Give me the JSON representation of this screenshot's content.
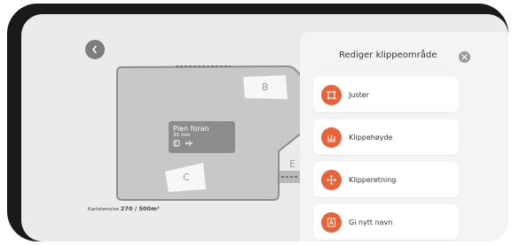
{
  "map": {
    "zone_labels": [
      "B",
      "C",
      "E"
    ],
    "area_card": {
      "title": "Plen foran",
      "height": "35 mm",
      "icons": [
        "square-icon",
        "airplane-icon"
      ]
    },
    "map_size": {
      "label": "Kartstørrelse",
      "value": "270 / 500m²"
    }
  },
  "panel": {
    "title": "Rediger klippeområde",
    "items": [
      {
        "label": "Juster",
        "icon": "adjust-icon"
      },
      {
        "label": "Klippehøyde",
        "icon": "cutting-height-icon"
      },
      {
        "label": "Klipperetning",
        "icon": "direction-icon"
      },
      {
        "label": "Gi nytt navn",
        "icon": "rename-icon"
      }
    ]
  },
  "colors": {
    "accent": "#e8623a",
    "background": "#ebebeb",
    "zone_fill": "#c8c8c8",
    "zone_border": "#8e8e8e"
  }
}
